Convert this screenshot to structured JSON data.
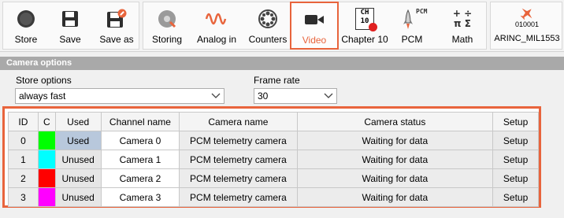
{
  "toolbar": {
    "store": "Store",
    "save": "Save",
    "save_as": "Save as",
    "storing": "Storing",
    "analog_in": "Analog in",
    "counters": "Counters",
    "video": "Video",
    "chapter10": "Chapter 10",
    "chapter10_icon_top": "CH",
    "chapter10_icon_bottom": "10",
    "pcm": "PCM",
    "pcm_icon_text": "PCM",
    "math": "Math",
    "math_icon_top": "+ ÷",
    "math_icon_bottom": "π Σ",
    "arinc": "ARINC_MIL1553",
    "arinc_icon_code": "010001"
  },
  "section": {
    "title": "Camera options"
  },
  "store_options": {
    "label": "Store options",
    "value": "always fast"
  },
  "frame_rate": {
    "label": "Frame rate",
    "value": "30"
  },
  "table": {
    "headers": [
      "ID",
      "C",
      "Used",
      "Channel name",
      "Camera name",
      "Camera status",
      "Setup"
    ],
    "rows": [
      {
        "id": "0",
        "color": "#00ff00",
        "used": "Used",
        "channel": "Camera 0",
        "camera": "PCM telemetry camera",
        "status": "Waiting for data",
        "setup": "Setup"
      },
      {
        "id": "1",
        "color": "#00ffff",
        "used": "Unused",
        "channel": "Camera 1",
        "camera": "PCM telemetry camera",
        "status": "Waiting for data",
        "setup": "Setup"
      },
      {
        "id": "2",
        "color": "#ff0000",
        "used": "Unused",
        "channel": "Camera 2",
        "camera": "PCM telemetry camera",
        "status": "Waiting for data",
        "setup": "Setup"
      },
      {
        "id": "3",
        "color": "#ff00ff",
        "used": "Unused",
        "channel": "Camera 3",
        "camera": "PCM telemetry camera",
        "status": "Waiting for data",
        "setup": "Setup"
      }
    ]
  },
  "colors": {
    "accent": "#e8643c",
    "section_bar": "#a9a9a9",
    "used_cell": "#b8c8dc"
  }
}
